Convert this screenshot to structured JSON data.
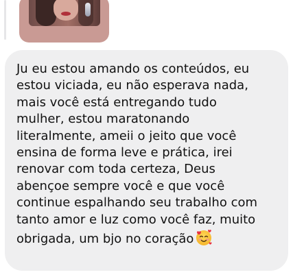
{
  "thread": {
    "reply_preview": {
      "icon": "story-photo-thumbnail"
    },
    "message": {
      "text": "Ju eu estou amando os conteúdos, eu\nestou viciada, eu não esperava nada,\nmais você está entregando tudo\nmulher, estou maratonando\nliteralmente, ameii o jeito que você\nensina de forma leve e prática, irei\nrenovar com toda certeza, Deus\nabençoe sempre você e que você\ncontinue espalhando seu trabalho com\ntanto amor e luz como você faz, muito\nobrigada, um bjo no coração",
      "emoji": "smiling-face-with-hearts-icon"
    }
  },
  "colors": {
    "bubble_background": "#efeff0",
    "text": "#111111",
    "preview_background": "#c99a94"
  }
}
